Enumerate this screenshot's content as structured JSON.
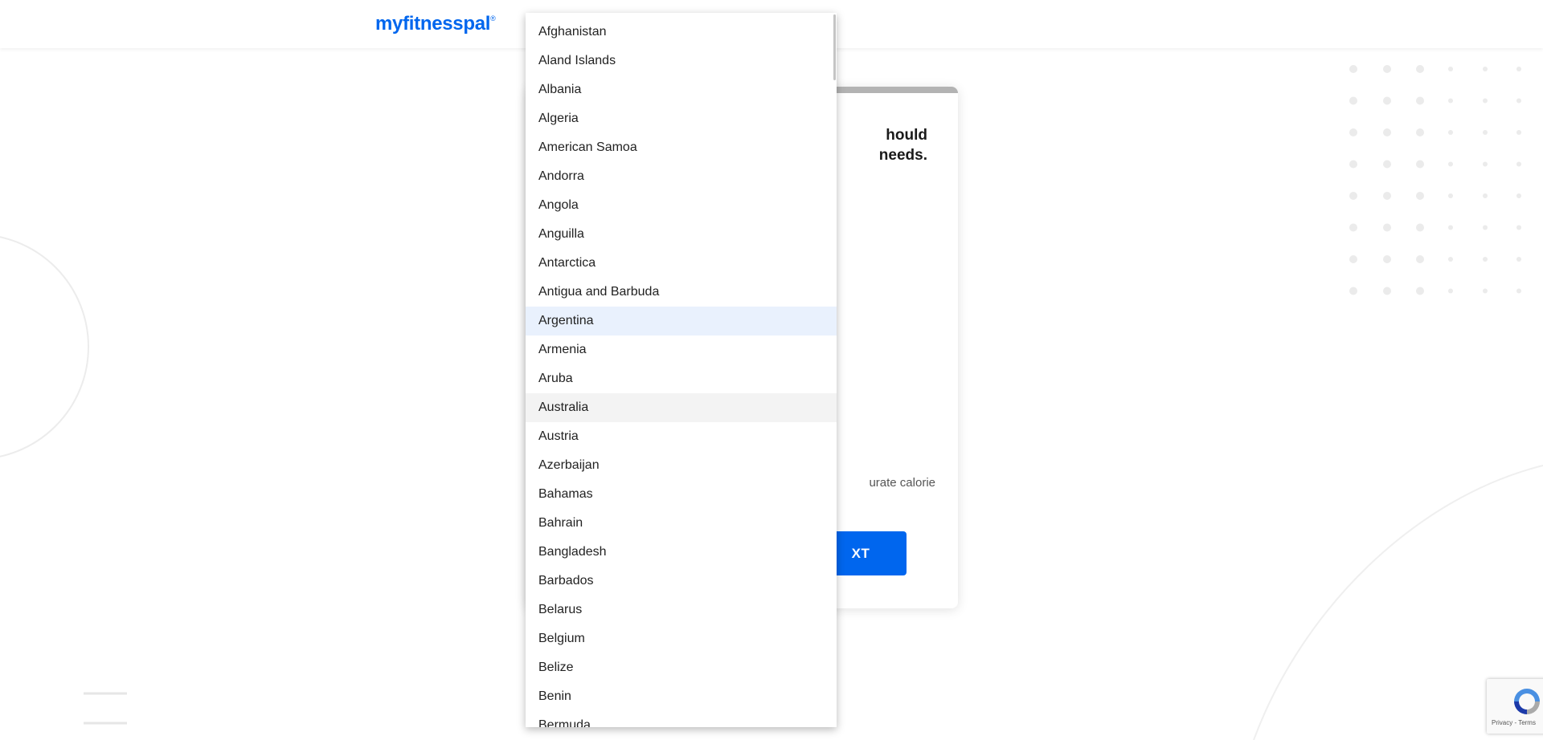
{
  "header": {
    "logo_text": "myfitnesspal",
    "logo_mark": "®"
  },
  "card": {
    "heading_line1": "hould",
    "heading_line2": "needs.",
    "note": "urate calorie",
    "next_button": "XT"
  },
  "dropdown": {
    "options": [
      "Afghanistan",
      "Aland Islands",
      "Albania",
      "Algeria",
      "American Samoa",
      "Andorra",
      "Angola",
      "Anguilla",
      "Antarctica",
      "Antigua and Barbuda",
      "Argentina",
      "Armenia",
      "Aruba",
      "Australia",
      "Austria",
      "Azerbaijan",
      "Bahamas",
      "Bahrain",
      "Bangladesh",
      "Barbados",
      "Belarus",
      "Belgium",
      "Belize",
      "Benin",
      "Bermuda"
    ],
    "selected": "Argentina",
    "hovered": "Australia"
  },
  "recaptcha": {
    "text": "Privacy - Terms"
  },
  "colors": {
    "brand": "#0066ee",
    "selected_bg": "#e9f1fd",
    "hover_bg": "#f3f3f3"
  }
}
